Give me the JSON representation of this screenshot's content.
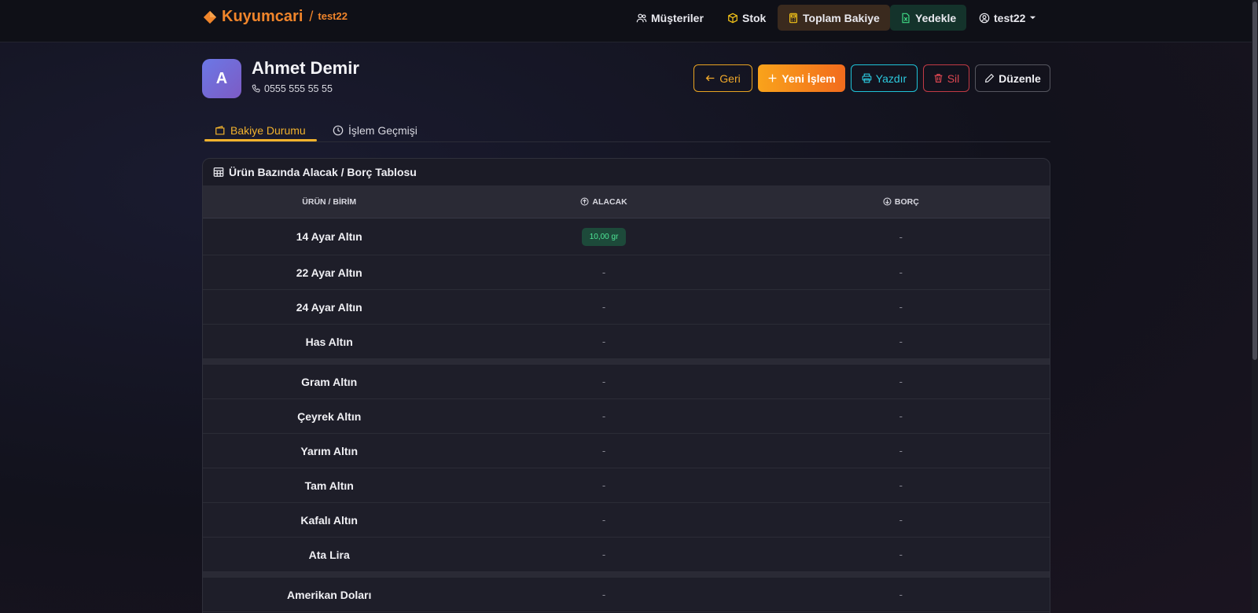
{
  "brand": {
    "name": "Kuyumcari",
    "separator": "/",
    "user": "test22"
  },
  "nav": {
    "musteriler": "Müşteriler",
    "stok": "Stok",
    "toplam_bakiye": "Toplam Bakiye",
    "yedekle": "Yedekle",
    "user": "test22"
  },
  "customer": {
    "initial": "A",
    "name": "Ahmet Demir",
    "phone": "0555 555 55 55"
  },
  "actions": {
    "geri": "Geri",
    "yeni_islem": "Yeni İşlem",
    "yazdir": "Yazdır",
    "sil": "Sil",
    "duzenle": "Düzenle"
  },
  "tabs": {
    "bakiye": "Bakiye Durumu",
    "islem": "İşlem Geçmişi"
  },
  "table": {
    "title": "Ürün Bazında Alacak / Borç Tablosu",
    "headers": {
      "urun": "ÜRÜN / BİRİM",
      "alacak": "ALACAK",
      "borc": "BORÇ"
    },
    "rows": [
      {
        "product": "14 Ayar Altın",
        "alacak": "10,00 gr",
        "borc": "-"
      },
      {
        "product": "22 Ayar Altın",
        "alacak": "-",
        "borc": "-"
      },
      {
        "product": "24 Ayar Altın",
        "alacak": "-",
        "borc": "-"
      },
      {
        "product": "Has Altın",
        "alacak": "-",
        "borc": "-"
      },
      {
        "product": "Gram Altın",
        "alacak": "-",
        "borc": "-"
      },
      {
        "product": "Çeyrek Altın",
        "alacak": "-",
        "borc": "-"
      },
      {
        "product": "Yarım Altın",
        "alacak": "-",
        "borc": "-"
      },
      {
        "product": "Tam Altın",
        "alacak": "-",
        "borc": "-"
      },
      {
        "product": "Kafalı Altın",
        "alacak": "-",
        "borc": "-"
      },
      {
        "product": "Ata Lira",
        "alacak": "-",
        "borc": "-"
      },
      {
        "product": "Amerikan Doları",
        "alacak": "-",
        "borc": "-"
      }
    ]
  }
}
